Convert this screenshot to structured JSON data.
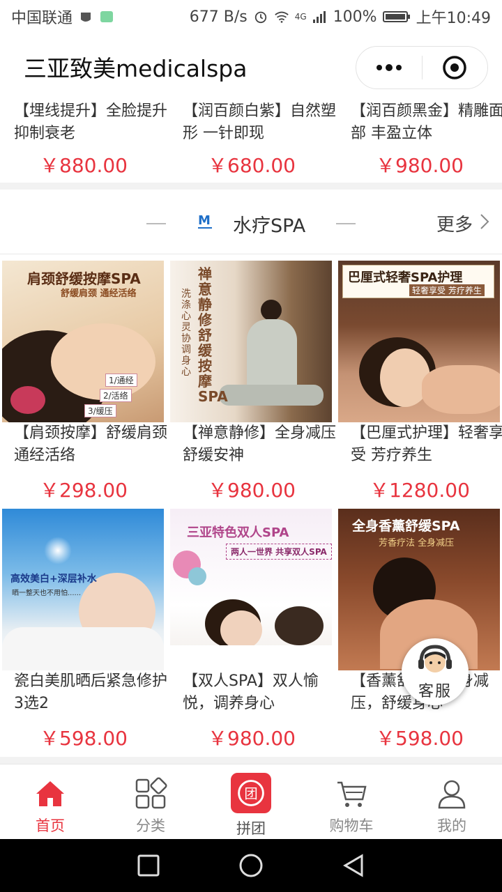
{
  "statusbar": {
    "carrier": "中国联通",
    "speed": "677 B/s",
    "network": "4G",
    "battery": "100%",
    "time": "上午10:49"
  },
  "titlebar": {
    "title": "三亚致美medicalspa"
  },
  "top_products": [
    {
      "name": "【埋线提升】全脸提升 抑制衰老",
      "price": "￥880.00"
    },
    {
      "name": "【润百颜白紫】自然塑形 一针即现",
      "price": "￥680.00"
    },
    {
      "name": "【润百颜黑金】精雕面部 丰盈立体",
      "price": "￥980.00"
    }
  ],
  "section": {
    "logo_text": "M",
    "title": "水疗SPA",
    "more": "更多"
  },
  "spa_products": [
    {
      "name": "【肩颈按摩】舒缓肩颈 通经活络",
      "price": "￥298.00",
      "image_caption": "肩颈舒缓按摩SPA",
      "image_sub": "舒缓肩颈 通经活络",
      "image_tags": [
        "1/通经",
        "2/活络",
        "3/缓压"
      ]
    },
    {
      "name": "【禅意静修】全身减压 舒缓安神",
      "price": "￥980.00",
      "image_caption": "禅意静修舒缓按摩SPA",
      "image_sub": "洗涤心灵 协调身心"
    },
    {
      "name": "【巴厘式护理】轻奢享受 芳疗养生",
      "price": "￥1280.00",
      "image_caption": "巴厘式轻奢SPA护理",
      "image_sub": "轻奢享受 芳疗养生"
    },
    {
      "name": "瓷白美肌晒后紧急修护3选2",
      "price": "￥598.00",
      "image_caption": "高效美白+深层补水",
      "image_sub": "晒一整天也不用怕......"
    },
    {
      "name": "【双人SPA】双人愉悦，调养身心",
      "price": "￥980.00",
      "image_caption": "三亚特色双人SPA",
      "image_sub": "两人一世界 共享双人SPA"
    },
    {
      "name": "【香薰舒缓】全身减压，舒缓身心",
      "price": "￥598.00",
      "image_caption": "全身香薰舒缓SPA",
      "image_sub": "芳香疗法 全身减压"
    }
  ],
  "kefu": {
    "label": "客服"
  },
  "tabbar": {
    "tabs": [
      {
        "label": "首页",
        "icon": "home-icon"
      },
      {
        "label": "分类",
        "icon": "category-icon"
      },
      {
        "label": "拼团",
        "icon": "group-buy-icon"
      },
      {
        "label": "购物车",
        "icon": "cart-icon"
      },
      {
        "label": "我的",
        "icon": "user-icon"
      }
    ]
  },
  "colors": {
    "accent": "#e8343f",
    "price": "#e8343f"
  }
}
